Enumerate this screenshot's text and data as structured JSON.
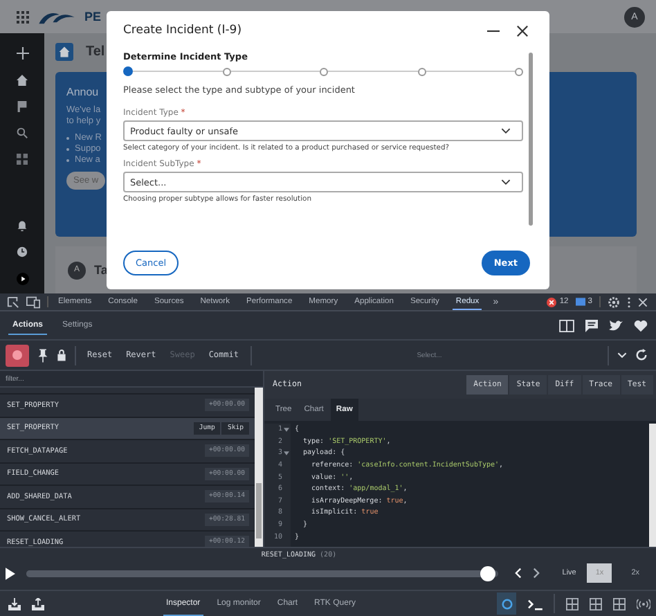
{
  "app": {
    "logo_text": "PE",
    "user_avatar": "A",
    "page_title": "Tel",
    "announcement": {
      "title": "Annou",
      "lines": [
        "We've la",
        "to help y"
      ],
      "bullets": [
        "New R",
        "Suppo",
        "New a"
      ],
      "button": "See w"
    },
    "task": {
      "avatar": "A",
      "title": "Ta"
    }
  },
  "modal": {
    "title": "Create Incident (I-9)",
    "step_title": "Determine Incident Type",
    "steps": [
      {
        "selected": true
      },
      {
        "selected": false
      },
      {
        "selected": false
      },
      {
        "selected": false
      },
      {
        "selected": false
      }
    ],
    "instruction": "Please select the type and subtype of your incident",
    "fields": [
      {
        "label": "Incident Type",
        "required_mark": "*",
        "value": "Product faulty or unsafe",
        "hint": "Select category of your incident. Is it related to a product purchased or service requested?"
      },
      {
        "label": "Incident SubType",
        "required_mark": "*",
        "placeholder": "Select...",
        "hint": "Choosing proper subtype allows for faster resolution"
      }
    ],
    "cancel": "Cancel",
    "next": "Next"
  },
  "devtools": {
    "tabs": [
      {
        "label": "Elements",
        "selected": false
      },
      {
        "label": "Console",
        "selected": false
      },
      {
        "label": "Sources",
        "selected": false
      },
      {
        "label": "Network",
        "selected": false
      },
      {
        "label": "Performance",
        "selected": false
      },
      {
        "label": "Memory",
        "selected": false
      },
      {
        "label": "Application",
        "selected": false
      },
      {
        "label": "Security",
        "selected": false
      },
      {
        "label": "Redux",
        "selected": true
      }
    ],
    "more": "»",
    "errors": "12",
    "messages": "3",
    "redux_tabs": [
      {
        "label": "Actions",
        "selected": true
      },
      {
        "label": "Settings",
        "selected": false
      }
    ],
    "toolbar": [
      {
        "label": "Reset",
        "disabled": false
      },
      {
        "label": "Revert",
        "disabled": false
      },
      {
        "label": "Sweep",
        "disabled": true
      },
      {
        "label": "Commit",
        "disabled": false
      }
    ],
    "instance_select": "Select...",
    "filter_placeholder": "filter...",
    "actions": [
      {
        "name": "SET_PROPERTY",
        "time": "+00:00.00",
        "selected": false
      },
      {
        "name": "SET_PROPERTY",
        "selected": true
      },
      {
        "name": "FETCH_DATAPAGE",
        "time": "+00:00.00",
        "selected": false
      },
      {
        "name": "FIELD_CHANGE",
        "time": "+00:00.00",
        "selected": false
      },
      {
        "name": "ADD_SHARED_DATA",
        "time": "+00:00.14",
        "selected": false
      },
      {
        "name": "SHOW_CANCEL_ALERT",
        "time": "+00:28.81",
        "selected": false
      },
      {
        "name": "RESET_LOADING",
        "time": "+00:00.12",
        "selected": false
      }
    ],
    "row_buttons": [
      "Jump",
      "Skip"
    ],
    "panel_title": "Action",
    "panel_tabs": [
      {
        "label": "Action",
        "selected": true
      },
      {
        "label": "State",
        "selected": false
      },
      {
        "label": "Diff",
        "selected": false
      },
      {
        "label": "Trace",
        "selected": false
      },
      {
        "label": "Test",
        "selected": false
      }
    ],
    "view_tabs": [
      {
        "label": "Tree",
        "selected": false
      },
      {
        "label": "Chart",
        "selected": false
      },
      {
        "label": "Raw",
        "selected": true
      }
    ],
    "code": [
      {
        "number": "1",
        "fold": true,
        "tokens": [
          {
            "text": "{",
            "kind": "plain"
          }
        ]
      },
      {
        "number": "2",
        "fold": false,
        "tokens": [
          {
            "text": "  type: ",
            "kind": "plain"
          },
          {
            "text": "'SET_PROPERTY'",
            "kind": "string"
          },
          {
            "text": ",",
            "kind": "plain"
          }
        ]
      },
      {
        "number": "3",
        "fold": true,
        "tokens": [
          {
            "text": "  payload: {",
            "kind": "plain"
          }
        ]
      },
      {
        "number": "4",
        "fold": false,
        "tokens": [
          {
            "text": "    reference: ",
            "kind": "plain"
          },
          {
            "text": "'caseInfo.content.IncidentSubType'",
            "kind": "string"
          },
          {
            "text": ",",
            "kind": "plain"
          }
        ]
      },
      {
        "number": "5",
        "fold": false,
        "tokens": [
          {
            "text": "    value: ",
            "kind": "plain"
          },
          {
            "text": "''",
            "kind": "string"
          },
          {
            "text": ",",
            "kind": "plain"
          }
        ]
      },
      {
        "number": "6",
        "fold": false,
        "tokens": [
          {
            "text": "    context: ",
            "kind": "plain"
          },
          {
            "text": "'app/modal_1'",
            "kind": "string"
          },
          {
            "text": ",",
            "kind": "plain"
          }
        ]
      },
      {
        "number": "7",
        "fold": false,
        "tokens": [
          {
            "text": "    isArrayDeepMerge: ",
            "kind": "plain"
          },
          {
            "text": "true",
            "kind": "keyword"
          },
          {
            "text": ",",
            "kind": "plain"
          }
        ]
      },
      {
        "number": "8",
        "fold": false,
        "tokens": [
          {
            "text": "    isImplicit: ",
            "kind": "plain"
          },
          {
            "text": "true",
            "kind": "keyword"
          }
        ]
      },
      {
        "number": "9",
        "fold": false,
        "tokens": [
          {
            "text": "  }",
            "kind": "plain"
          }
        ]
      },
      {
        "number": "10",
        "fold": false,
        "tokens": [
          {
            "text": "}",
            "kind": "plain"
          }
        ]
      }
    ],
    "slider": {
      "action": "RESET_LOADING",
      "count": "(20)",
      "level": 0.98,
      "live": "Live",
      "speeds": [
        {
          "label": "1x",
          "selected": true
        },
        {
          "label": "2x",
          "selected": false
        }
      ]
    },
    "bottom_tabs": [
      {
        "label": "Inspector",
        "selected": true
      },
      {
        "label": "Log monitor",
        "selected": false
      },
      {
        "label": "Chart",
        "selected": false
      },
      {
        "label": "RTK Query",
        "selected": false
      }
    ]
  }
}
